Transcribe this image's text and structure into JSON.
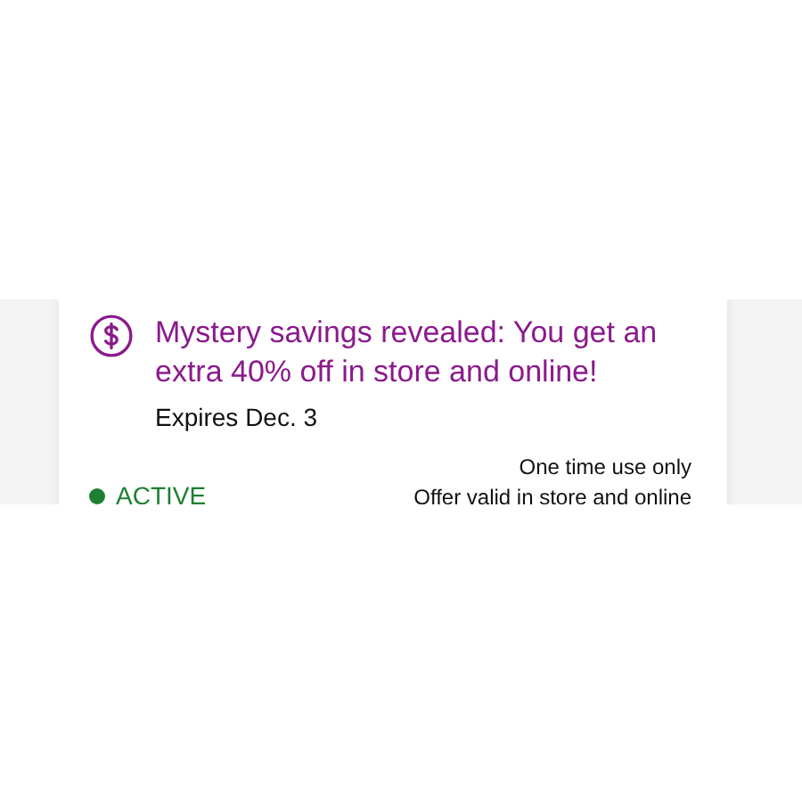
{
  "offer": {
    "title": "Mystery savings revealed: You get an extra 40% off in store and online!",
    "expiry": "Expires Dec. 3",
    "status": {
      "label": "ACTIVE",
      "active": true
    },
    "terms": [
      "One time use only",
      "Offer valid in store and online"
    ]
  }
}
